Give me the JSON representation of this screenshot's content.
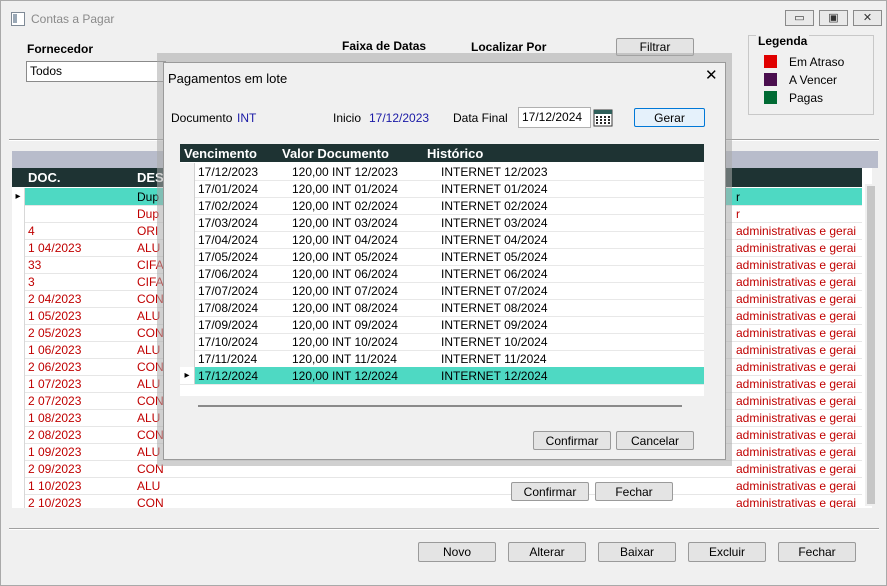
{
  "window": {
    "title": "Contas a Pagar",
    "minimize_glyph": "▭",
    "maximize_glyph": "▣",
    "close_glyph": "✕"
  },
  "filters": {
    "fornecedor_label": "Fornecedor",
    "fornecedor_value": "Todos",
    "faixa_label": "Faixa de Datas",
    "localizar_label": "Localizar Por",
    "filtrar_label": "Filtrar"
  },
  "legend": {
    "title": "Legenda",
    "items": [
      {
        "label": "Em Atraso",
        "color": "#e00000"
      },
      {
        "label": "A Vencer",
        "color": "#4a0e4e"
      },
      {
        "label": "Pagas",
        "color": "#006a33"
      }
    ]
  },
  "main_grid": {
    "columns": [
      "DOC.",
      "DES"
    ],
    "rows": [
      {
        "doc": "",
        "des": "Dup",
        "right": "r",
        "selected": true
      },
      {
        "doc": "",
        "des": "Dup",
        "right": "r",
        "selected": false
      },
      {
        "doc": "4",
        "des": "ORI",
        "right": "administrativas e gerai",
        "selected": false
      },
      {
        "doc": "1 04/2023",
        "des": "ALU",
        "right": "administrativas e gerai",
        "selected": false
      },
      {
        "doc": "33",
        "des": "CIFA",
        "right": "administrativas e gerai",
        "selected": false
      },
      {
        "doc": "3",
        "des": "CIFA",
        "right": "administrativas e gerai",
        "selected": false
      },
      {
        "doc": "2 04/2023",
        "des": "CON",
        "right": "administrativas e gerai",
        "selected": false
      },
      {
        "doc": "1 05/2023",
        "des": "ALU",
        "right": "administrativas e gerai",
        "selected": false
      },
      {
        "doc": "2 05/2023",
        "des": "CON",
        "right": "administrativas e gerai",
        "selected": false
      },
      {
        "doc": "1 06/2023",
        "des": "ALU",
        "right": "administrativas e gerai",
        "selected": false
      },
      {
        "doc": "2 06/2023",
        "des": "CON",
        "right": "administrativas e gerai",
        "selected": false
      },
      {
        "doc": "1 07/2023",
        "des": "ALU",
        "right": "administrativas e gerai",
        "selected": false
      },
      {
        "doc": "2 07/2023",
        "des": "CON",
        "right": "administrativas e gerai",
        "selected": false
      },
      {
        "doc": "1 08/2023",
        "des": "ALU",
        "right": "administrativas e gerai",
        "selected": false
      },
      {
        "doc": "2 08/2023",
        "des": "CON",
        "right": "administrativas e gerai",
        "selected": false
      },
      {
        "doc": "1 09/2023",
        "des": "ALU",
        "right": "administrativas e gerai",
        "selected": false
      },
      {
        "doc": "2 09/2023",
        "des": "CON",
        "right": "administrativas e gerai",
        "selected": false
      },
      {
        "doc": "1 10/2023",
        "des": "ALU",
        "right": "administrativas e gerai",
        "selected": false
      },
      {
        "doc": "2 10/2023",
        "des": "CON",
        "right": "administrativas e gerai",
        "selected": false
      }
    ],
    "selected_color": "#4ed9c3",
    "text_color": "#c00000"
  },
  "inner_buttons": {
    "confirmar": "Confirmar",
    "fechar": "Fechar"
  },
  "bottom_buttons": {
    "novo": "Novo",
    "alterar": "Alterar",
    "baixar": "Baixar",
    "excluir": "Excluir",
    "fechar": "Fechar"
  },
  "dialog": {
    "title": "Pagamentos em lote",
    "close_glyph": "✕",
    "documento_label": "Documento",
    "documento_value": "INT",
    "inicio_label": "Inicio",
    "inicio_value": "17/12/2023",
    "data_final_label": "Data Final",
    "data_final_value": "17/12/2024",
    "calendar_icon": "calendar-icon",
    "gerar_label": "Gerar",
    "columns": [
      "Vencimento",
      "Valor Documento",
      "Histórico"
    ],
    "rows": [
      {
        "vencimento": "17/12/2023",
        "desc": "120,00 INT 12/2023",
        "historico": "INTERNET 12/2023",
        "selected": false
      },
      {
        "vencimento": "17/01/2024",
        "desc": "120,00 INT 01/2024",
        "historico": "INTERNET 01/2024",
        "selected": false
      },
      {
        "vencimento": "17/02/2024",
        "desc": "120,00 INT 02/2024",
        "historico": "INTERNET 02/2024",
        "selected": false
      },
      {
        "vencimento": "17/03/2024",
        "desc": "120,00 INT 03/2024",
        "historico": "INTERNET 03/2024",
        "selected": false
      },
      {
        "vencimento": "17/04/2024",
        "desc": "120,00 INT 04/2024",
        "historico": "INTERNET 04/2024",
        "selected": false
      },
      {
        "vencimento": "17/05/2024",
        "desc": "120,00 INT 05/2024",
        "historico": "INTERNET 05/2024",
        "selected": false
      },
      {
        "vencimento": "17/06/2024",
        "desc": "120,00 INT 06/2024",
        "historico": "INTERNET 06/2024",
        "selected": false
      },
      {
        "vencimento": "17/07/2024",
        "desc": "120,00 INT 07/2024",
        "historico": "INTERNET 07/2024",
        "selected": false
      },
      {
        "vencimento": "17/08/2024",
        "desc": "120,00 INT 08/2024",
        "historico": "INTERNET 08/2024",
        "selected": false
      },
      {
        "vencimento": "17/09/2024",
        "desc": "120,00 INT 09/2024",
        "historico": "INTERNET 09/2024",
        "selected": false
      },
      {
        "vencimento": "17/10/2024",
        "desc": "120,00 INT 10/2024",
        "historico": "INTERNET 10/2024",
        "selected": false
      },
      {
        "vencimento": "17/11/2024",
        "desc": "120,00 INT 11/2024",
        "historico": "INTERNET 11/2024",
        "selected": false
      },
      {
        "vencimento": "17/12/2024",
        "desc": "120,00 INT 12/2024",
        "historico": "INTERNET 12/2024",
        "selected": true
      }
    ],
    "confirmar_label": "Confirmar",
    "cancelar_label": "Cancelar",
    "value_color": "#1a1aa6"
  }
}
